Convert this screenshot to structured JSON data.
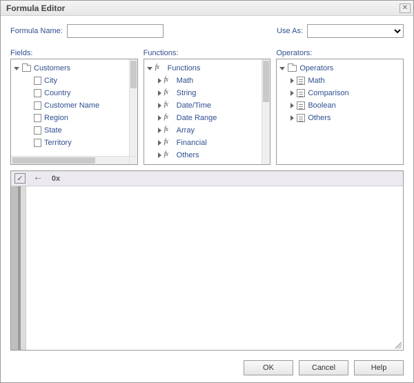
{
  "title": "Formula Editor",
  "form": {
    "name_label": "Formula Name:",
    "name_value": "",
    "useas_label": "Use As:",
    "useas_value": ""
  },
  "panels": {
    "fields": {
      "header": "Fields:",
      "root": "Customers",
      "items": [
        "City",
        "Country",
        "Customer Name",
        "Region",
        "State",
        "Territory"
      ]
    },
    "functions": {
      "header": "Functions:",
      "root": "Functions",
      "items": [
        "Math",
        "String",
        "Date/Time",
        "Date Range",
        "Array",
        "Financial",
        "Others"
      ]
    },
    "operators": {
      "header": "Operators:",
      "root": "Operators",
      "items": [
        "Math",
        "Comparison",
        "Boolean",
        "Others"
      ]
    }
  },
  "toolbar": {
    "check": "✓",
    "xpm": "+−",
    "hex": "0x"
  },
  "buttons": {
    "ok": "OK",
    "cancel": "Cancel",
    "help": "Help"
  }
}
